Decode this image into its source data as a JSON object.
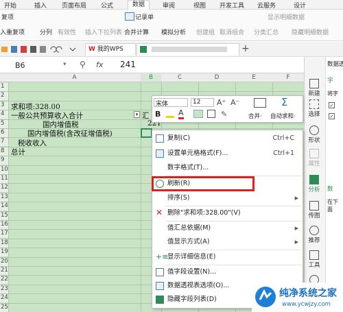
{
  "ribbon": {
    "tabs": [
      "开始",
      "插入",
      "页面布局",
      "公式",
      "数据",
      "审阅",
      "视图",
      "开发工具",
      "云服务",
      "设计"
    ],
    "active_tab": "数据",
    "row1": {
      "repeat": "复项",
      "record": "记录单",
      "outline_show": "显示明细数据"
    },
    "row2": {
      "remove_dup": "入重复项",
      "split": "分列",
      "validity": "有效性",
      "insert_dropdown": "插入下拉列表",
      "consolidate": "合并计算",
      "simulation": "模拟分析",
      "create_group": "创建组",
      "ungroup": "取消组合",
      "subtotal": "分类汇总",
      "hide_detail": "隐藏明细数据"
    }
  },
  "doc_tabs": {
    "home": "我的WPS",
    "add": "+"
  },
  "formula_bar": {
    "name_box": "B6",
    "fx": "fx",
    "value": "241"
  },
  "columns": [
    "A",
    "B",
    "C",
    "D",
    "E",
    "F"
  ],
  "rows": [
    "1",
    "2",
    "3",
    "4",
    "5",
    "6",
    "7",
    "8",
    "9",
    "10",
    "11",
    "12",
    "13",
    "14",
    "15",
    "16",
    "17",
    "18",
    "19",
    "20",
    "21",
    "22",
    "23",
    "24",
    "25"
  ],
  "cells": {
    "r3": "求和项:328.00",
    "r4a": "一般公共预算收入合计",
    "r4b": "汇",
    "r5a": "国内增值税",
    "r5b": "221",
    "r6a": "国内增值税(含改征增值税)",
    "r7a": "税收收入",
    "r8a": "总计"
  },
  "sidebar": {
    "items": [
      "新建",
      "选择",
      "形状",
      "属性",
      "分析",
      "传图",
      "推荐",
      "工具",
      "设置"
    ],
    "panel": {
      "title": "数据透",
      "word": "字",
      "hint": "将字",
      "section": "数",
      "below": "在下面"
    }
  },
  "minibar": {
    "font": "宋体",
    "size": "12",
    "bold": "B",
    "merge": "合并·",
    "autosum": "自动求和·",
    "sigma": "Σ"
  },
  "context_menu": {
    "items": [
      {
        "label": "复制(C)",
        "shortcut": "Ctrl+C"
      },
      {
        "label": "设置单元格格式(F)...",
        "shortcut": "Ctrl+1"
      },
      {
        "label": "数字格式(T)..."
      },
      {
        "label": "刷新(R)"
      },
      {
        "label": "排序(S)",
        "submenu": true
      },
      {
        "label": "删除\"求和项:328.00\"(V)"
      },
      {
        "label": "值汇总依据(M)",
        "submenu": true
      },
      {
        "label": "值显示方式(A)",
        "submenu": true
      },
      {
        "label": "显示详细信息(E)"
      },
      {
        "label": "值字段设置(N)..."
      },
      {
        "label": "数据透视表选项(O)..."
      },
      {
        "label": "隐藏字段列表(D)"
      }
    ]
  },
  "watermark": {
    "brand": "纯净系统之家",
    "url": "www.ycwjzy.com"
  },
  "colors": {
    "accent": "#2e8b57",
    "grid_bg": "#c8e4c5",
    "highlight": "#e02020"
  }
}
